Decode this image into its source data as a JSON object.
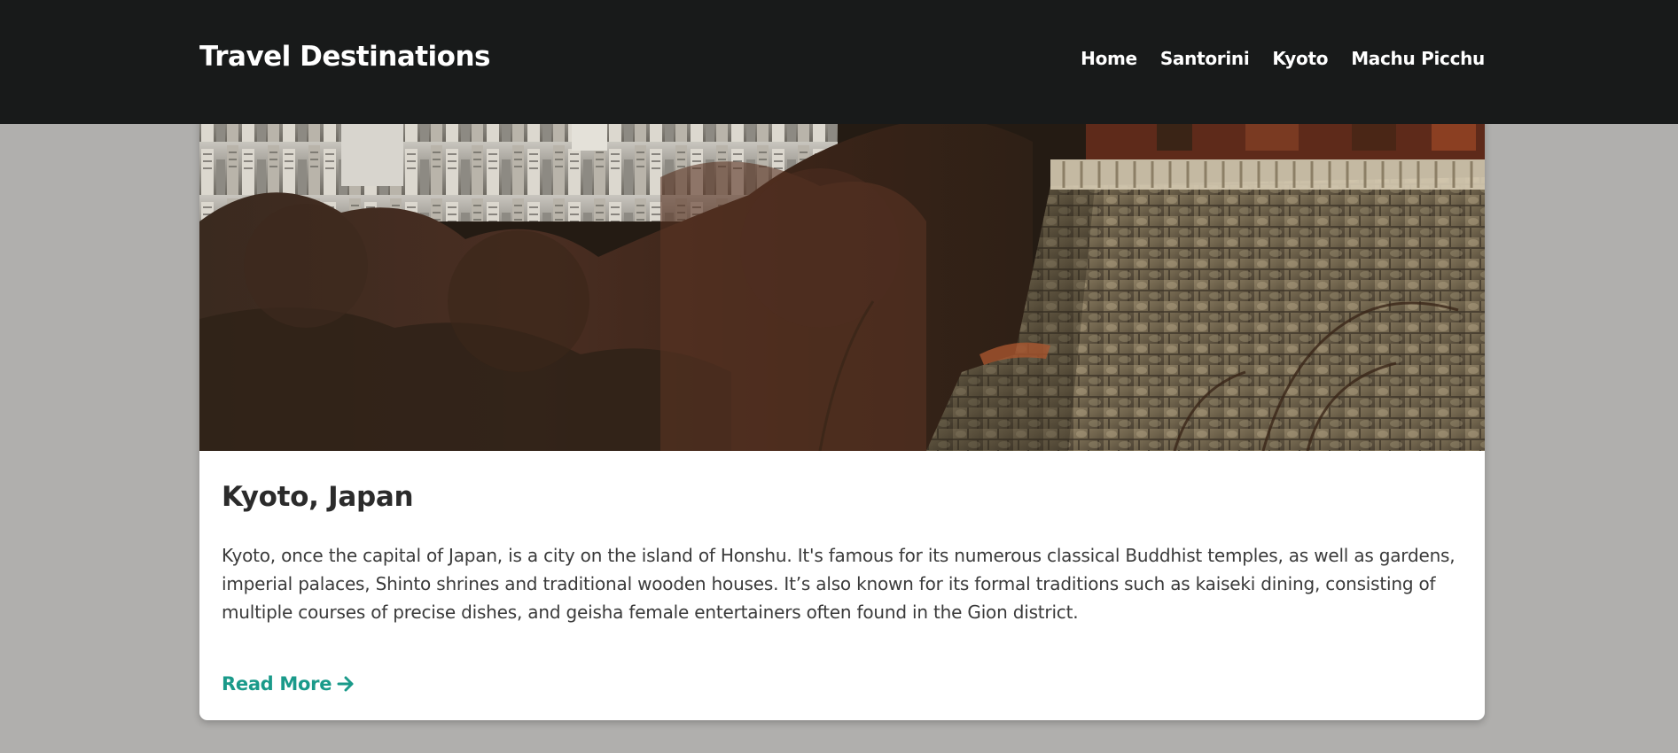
{
  "navbar": {
    "brand": "Travel Destinations",
    "links": [
      "Home",
      "Santorini",
      "Kyoto",
      "Machu Picchu"
    ]
  },
  "card": {
    "image_alt": "Kyoto temple terrace above autumn trees and city",
    "title": "Kyoto, Japan",
    "description": "Kyoto, once the capital of Japan, is a city on the island of Honshu. It's famous for its numerous classical Buddhist temples, as well as gardens, imperial palaces, Shinto shrines and traditional wooden houses. It’s also known for its formal traditions such as kaiseki dining, consisting of multiple courses of precise dishes, and geisha female entertainers often found in the Gion district.",
    "read_more": "Read More",
    "read_more_icon": "arrow-right-icon"
  },
  "colors": {
    "navbar_bg": "#181a1a",
    "page_bg": "#b0afad",
    "accent": "#1a9a8a"
  }
}
